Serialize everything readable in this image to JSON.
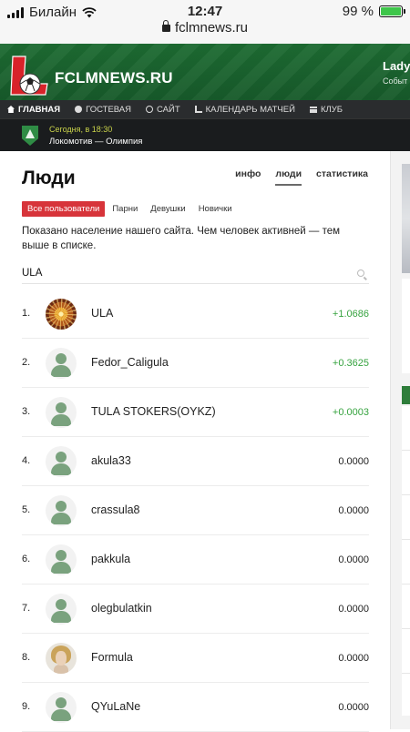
{
  "status_bar": {
    "carrier": "Билайн",
    "time": "12:47",
    "battery": "99 %"
  },
  "browser": {
    "url": "fclmnews.ru"
  },
  "header": {
    "logo": "FCLMNEWS.RU",
    "right_title": "Lady",
    "right_subtitle": "Событ"
  },
  "nav": [
    {
      "label": "ГЛАВНАЯ",
      "icon": "home-icon"
    },
    {
      "label": "ГОСТЕВАЯ",
      "icon": "chat-icon"
    },
    {
      "label": "САЙТ",
      "icon": "globe-icon"
    },
    {
      "label": "КАЛЕНДАРЬ МАТЧЕЙ",
      "icon": "chart-icon"
    },
    {
      "label": "КЛУБ",
      "icon": "menu-icon"
    }
  ],
  "match": {
    "when": "Сегодня, в 18:30",
    "teams": "Локомотив — Олимпия"
  },
  "page": {
    "title": "Люди",
    "tabs": [
      "инфо",
      "люди",
      "статистика"
    ],
    "filters": [
      "Все пользователи",
      "Парни",
      "Девушки",
      "Новички"
    ],
    "description": "Показано население нашего сайта. Чем человек активней — тем выше в списке.",
    "search_value": "ULA"
  },
  "people": [
    {
      "rank": "1.",
      "name": "ULA",
      "score": "+1.0686",
      "avatar": "sun"
    },
    {
      "rank": "2.",
      "name": "Fedor_Caligula",
      "score": "+0.3625",
      "avatar": "default"
    },
    {
      "rank": "3.",
      "name": "TULA STOKERS(OYKZ)",
      "score": "+0.0003",
      "avatar": "default"
    },
    {
      "rank": "4.",
      "name": "akula33",
      "score": "0.0000",
      "avatar": "default"
    },
    {
      "rank": "5.",
      "name": "crassula8",
      "score": "0.0000",
      "avatar": "default"
    },
    {
      "rank": "6.",
      "name": "pakkula",
      "score": "0.0000",
      "avatar": "default"
    },
    {
      "rank": "7.",
      "name": "olegbulatkin",
      "score": "0.0000",
      "avatar": "default"
    },
    {
      "rank": "8.",
      "name": "Formula",
      "score": "0.0000",
      "avatar": "photo"
    },
    {
      "rank": "9.",
      "name": "QYuLaNe",
      "score": "0.0000",
      "avatar": "default"
    }
  ],
  "colors": {
    "brand_green": "#1d6b32",
    "filter_active": "#d7343a",
    "positive": "#36a33f"
  }
}
